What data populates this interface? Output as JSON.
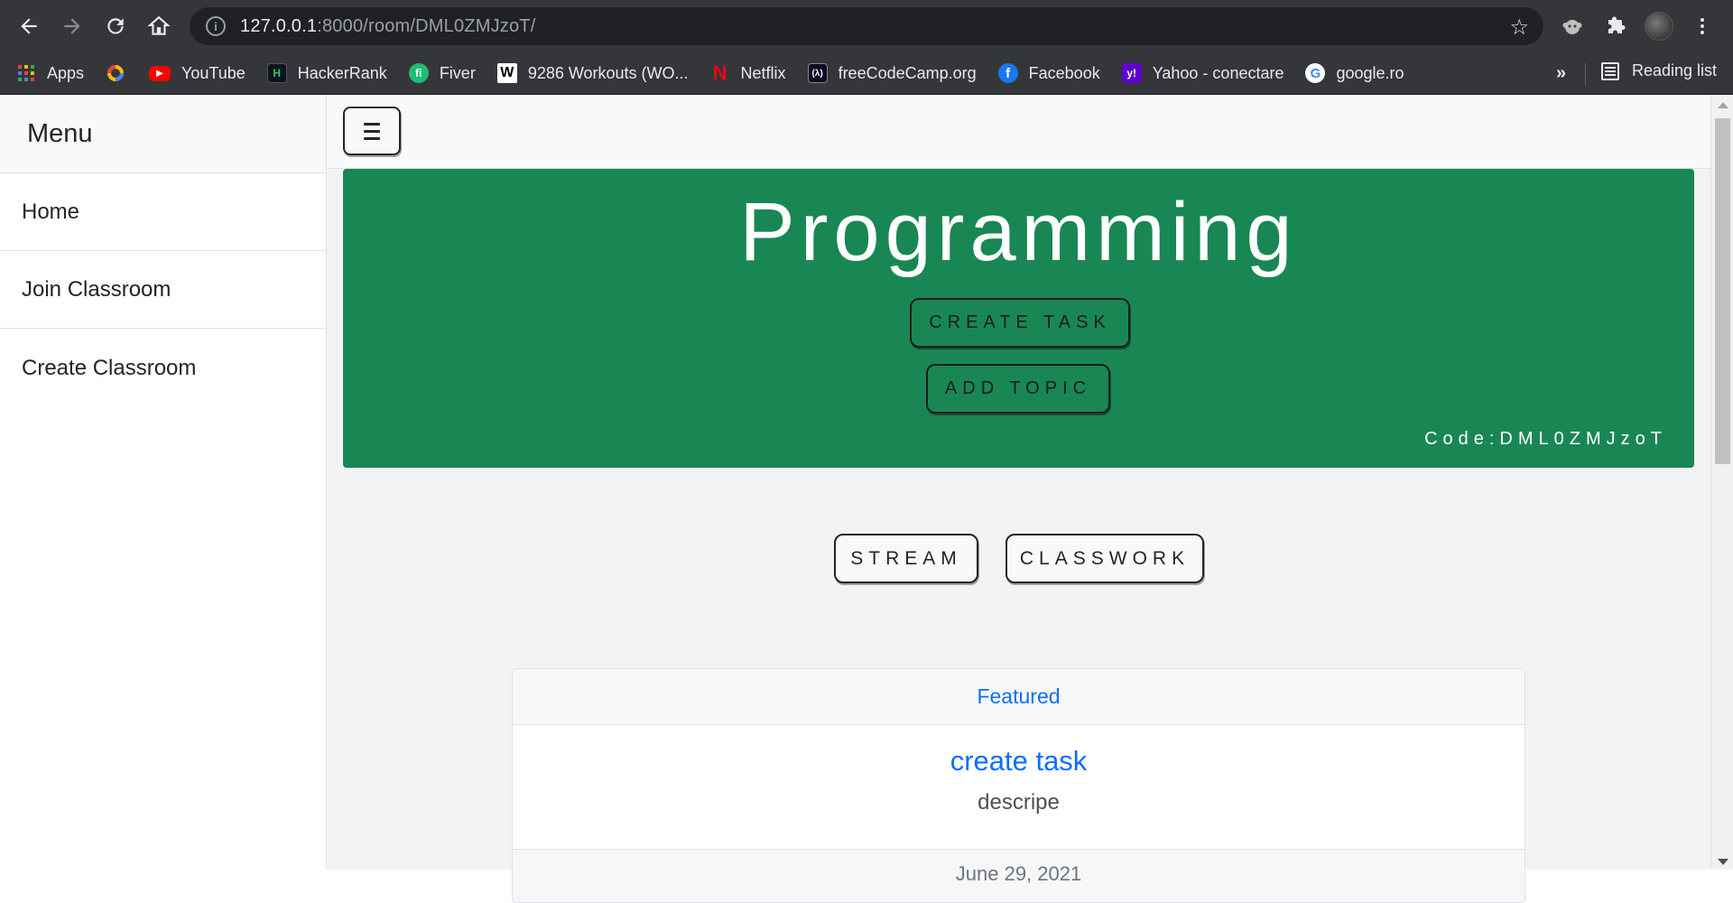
{
  "browser": {
    "url_host": "127.0.0.1",
    "url_rest": ":8000/room/DML0ZMJzoT/",
    "bookmarks": [
      {
        "label": "Apps",
        "icon": "apps-grid-icon",
        "color": "#4285f4"
      },
      {
        "label": "",
        "icon": "app-ring-icon",
        "color": "#ea4335"
      },
      {
        "label": "YouTube",
        "icon": "youtube-icon",
        "color": "#ff0000"
      },
      {
        "label": "HackerRank",
        "icon": "hackerrank-icon",
        "color": "#1ba94c"
      },
      {
        "label": "Fiver",
        "icon": "fiverr-icon",
        "color": "#1dbf73"
      },
      {
        "label": "9286 Workouts (WO...",
        "icon": "workouts-icon",
        "color": "#000000"
      },
      {
        "label": "Netflix",
        "icon": "netflix-icon",
        "color": "#e50914"
      },
      {
        "label": "freeCodeCamp.org",
        "icon": "freecodecamp-icon",
        "color": "#0a0a23"
      },
      {
        "label": "Facebook",
        "icon": "facebook-icon",
        "color": "#1877f2"
      },
      {
        "label": "Yahoo - conectare",
        "icon": "yahoo-icon",
        "color": "#6001d2"
      },
      {
        "label": "google.ro",
        "icon": "google-icon",
        "color": "#ffffff"
      }
    ],
    "more": "»",
    "reading_list": "Reading list"
  },
  "sidebar": {
    "title": "Menu",
    "items": [
      {
        "label": "Home"
      },
      {
        "label": "Join Classroom"
      },
      {
        "label": "Create Classroom"
      }
    ]
  },
  "banner": {
    "title": "Programming",
    "create_task": "CREATE TASK",
    "add_topic": "ADD TOPIC",
    "code": "Code:DML0ZMJzoT",
    "color": "#198754"
  },
  "tabs": {
    "stream": "STREAM",
    "classwork": "CLASSWORK"
  },
  "card": {
    "header": "Featured",
    "title": "create task",
    "text": "descripe",
    "footer": "June 29, 2021"
  }
}
